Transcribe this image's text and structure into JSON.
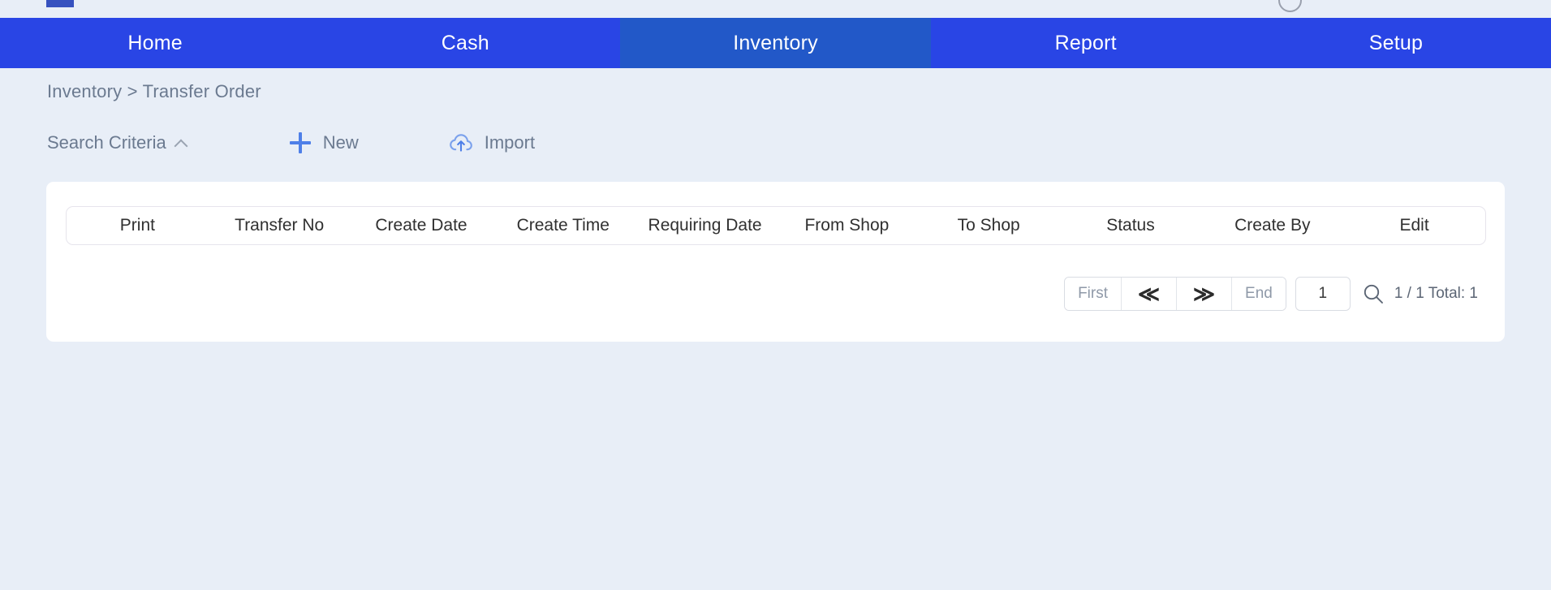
{
  "topbar": {
    "avatar_name": "user-avatar",
    "chip_name": "app-logo-chip"
  },
  "nav": {
    "active": "Inventory",
    "tabs": [
      {
        "label": "Home",
        "active": false
      },
      {
        "label": "Cash",
        "active": false
      },
      {
        "label": "Inventory",
        "active": true
      },
      {
        "label": "Report",
        "active": false
      },
      {
        "label": "Setup",
        "active": false
      }
    ]
  },
  "breadcrumb": {
    "text": "Inventory > Transfer Order"
  },
  "toolbar": {
    "search_criteria_label": "Search Criteria",
    "new_label": "New",
    "import_label": "Import"
  },
  "table": {
    "columns": [
      "Print",
      "Transfer No",
      "Create Date",
      "Create Time",
      "Requiring Date",
      "From Shop",
      "To Shop",
      "Status",
      "Create By",
      "Edit"
    ],
    "rows": []
  },
  "pagination": {
    "first_label": "First",
    "prev_label": "≪",
    "next_label": "≫",
    "end_label": "End",
    "page_value": "1",
    "summary": "1 / 1 Total: 1"
  },
  "colors": {
    "nav_blue": "#2945e5",
    "nav_active_blue": "#2258c8",
    "page_background": "#e8eef7",
    "card_white": "#ffffff",
    "accent_icon_blue": "#4e7fe8",
    "muted_text": "#6b7a90"
  }
}
